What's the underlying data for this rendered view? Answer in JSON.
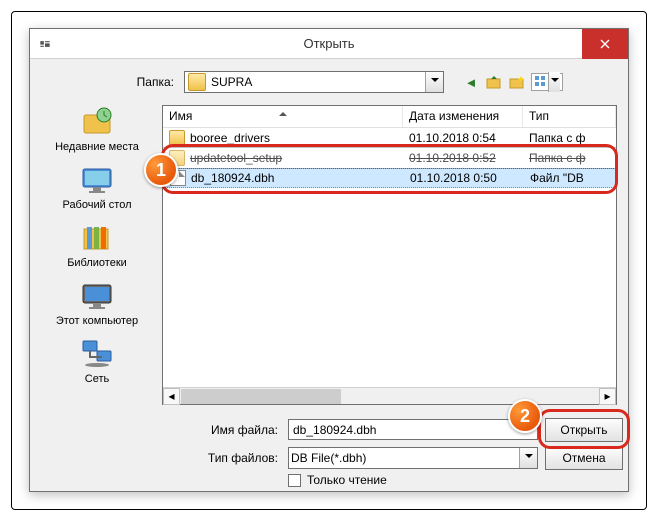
{
  "dialog": {
    "title": "Открыть"
  },
  "folder": {
    "label": "Папка:",
    "value": "SUPRA"
  },
  "places": [
    {
      "label": "Недавние места"
    },
    {
      "label": "Рабочий стол"
    },
    {
      "label": "Библиотеки"
    },
    {
      "label": "Этот компьютер"
    },
    {
      "label": "Сеть"
    }
  ],
  "columns": {
    "name": "Имя",
    "date": "Дата изменения",
    "type": "Тип"
  },
  "files": [
    {
      "name": "booree_drivers",
      "date": "01.10.2018 0:54",
      "type": "Папка с ф",
      "icon": "folder"
    },
    {
      "name": "updatetool_setup",
      "date": "01.10.2018 0:52",
      "type": "Папка с ф",
      "icon": "folder",
      "struck": true
    },
    {
      "name": "db_180924.dbh",
      "date": "01.10.2018 0:50",
      "type": "Файл \"DB",
      "icon": "file",
      "selected": true
    }
  ],
  "bottom": {
    "file_label": "Имя файла:",
    "file_value": "db_180924.dbh",
    "type_label": "Тип файлов:",
    "type_value": "DB File(*.dbh)",
    "readonly": "Только чтение",
    "open": "Открыть",
    "cancel": "Отмена"
  },
  "badges": {
    "one": "1",
    "two": "2"
  }
}
